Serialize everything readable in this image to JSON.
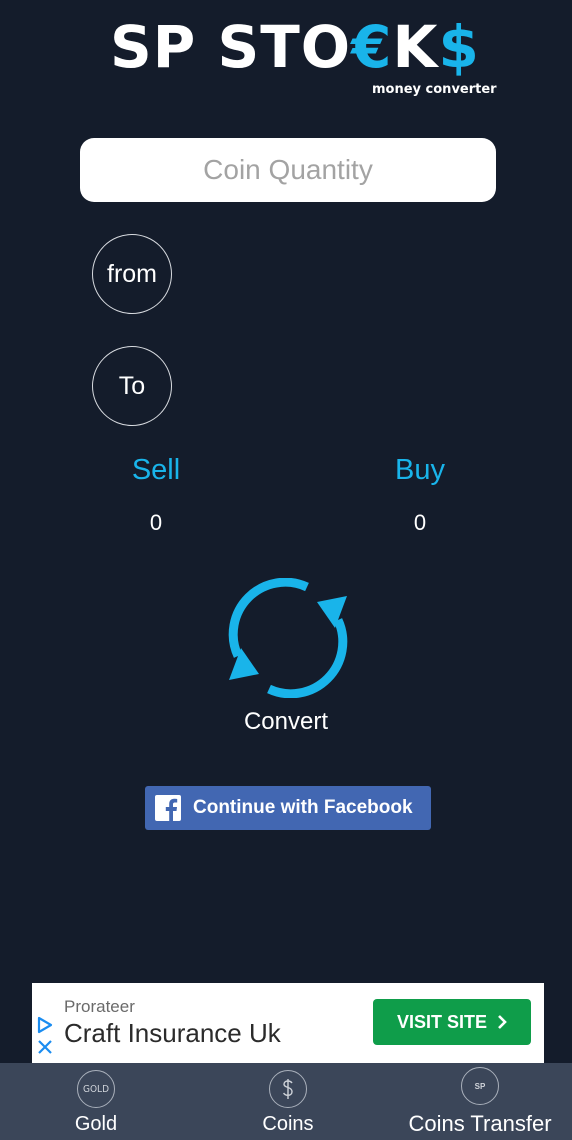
{
  "logo": {
    "main_prefix": "SP STO",
    "main_accent_1": "€",
    "main_mid": "K",
    "main_accent_2": "$",
    "subtitle": "money converter",
    "accent_color": "#19b4ea"
  },
  "converter": {
    "quantity_placeholder": "Coin Quantity",
    "quantity_value": "",
    "from_label": "from",
    "to_label": "To",
    "sell_label": "Sell",
    "sell_value": "0",
    "buy_label": "Buy",
    "buy_value": "0",
    "convert_icon": "refresh-arrows-icon",
    "convert_label": "Convert"
  },
  "facebook": {
    "label": "Continue with Facebook",
    "icon": "facebook-icon",
    "color": "#4267b2"
  },
  "ad": {
    "advertiser": "Prorateer",
    "title": "Craft Insurance Uk",
    "cta_label": "VISIT SITE",
    "cta_color": "#0f9d4a"
  },
  "bottom_nav": {
    "items": [
      {
        "label": "Gold",
        "icon": "gold-coin-icon",
        "icon_text": "GOLD"
      },
      {
        "label": "Coins",
        "icon": "dollar-coin-icon"
      },
      {
        "label": "Coins Transfer",
        "icon": "sp-transfer-icon",
        "icon_text": "SP"
      }
    ]
  },
  "colors": {
    "background": "#141c2b",
    "nav_background": "#3b4659"
  }
}
